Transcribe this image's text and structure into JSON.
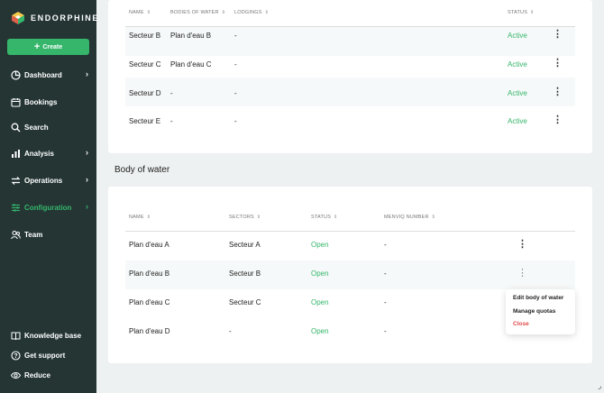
{
  "sidebar": {
    "brand": "ENDORPHINE",
    "create_label": "Create",
    "items": [
      {
        "label": "Dashboard",
        "icon": "pie-chart-icon",
        "chevron": true
      },
      {
        "label": "Bookings",
        "icon": "calendar-icon",
        "chevron": false
      },
      {
        "label": "Search",
        "icon": "search-icon",
        "chevron": false
      },
      {
        "label": "Analysis",
        "icon": "bar-chart-icon",
        "chevron": true
      },
      {
        "label": "Operations",
        "icon": "arrows-icon",
        "chevron": true
      },
      {
        "label": "Configuration",
        "icon": "sliders-icon",
        "chevron": true,
        "active": true
      },
      {
        "label": "Team",
        "icon": "users-icon",
        "chevron": false
      }
    ],
    "footer": [
      {
        "label": "Knowledge base",
        "icon": "book-icon"
      },
      {
        "label": "Get support",
        "icon": "help-icon"
      },
      {
        "label": "Reduce",
        "icon": "eye-icon"
      }
    ],
    "accent": "#35b66b",
    "background": "#243534"
  },
  "sectors_table": {
    "columns": [
      "NAME",
      "BODIES OF WATER",
      "LODGINGS",
      "STATUS"
    ],
    "rows": [
      {
        "name": "Secteur B",
        "water": "Plan d'eau B",
        "lodgings": "-",
        "status": "Active"
      },
      {
        "name": "Secteur C",
        "water": "Plan d'eau C",
        "lodgings": "-",
        "status": "Active"
      },
      {
        "name": "Secteur D",
        "water": "-",
        "lodgings": "-",
        "status": "Active"
      },
      {
        "name": "Secteur E",
        "water": "-",
        "lodgings": "-",
        "status": "Active"
      }
    ]
  },
  "water_section": {
    "title": "Body of water",
    "columns": [
      "NAME",
      "SECTORS",
      "STATUS",
      "MENVIQ NUMBER"
    ],
    "rows": [
      {
        "name": "Plan d'eau A",
        "sector": "Secteur A",
        "status": "Open",
        "menviq": "-"
      },
      {
        "name": "Plan d'eau B",
        "sector": "Secteur B",
        "status": "Open",
        "menviq": "-"
      },
      {
        "name": "Plan d'eau C",
        "sector": "Secteur C",
        "status": "Open",
        "menviq": "-"
      },
      {
        "name": "Plan d'eau D",
        "sector": "-",
        "status": "Open",
        "menviq": "-"
      }
    ]
  },
  "row_menu": {
    "items": [
      "Edit body of water",
      "Manage quotas",
      "Close"
    ]
  }
}
